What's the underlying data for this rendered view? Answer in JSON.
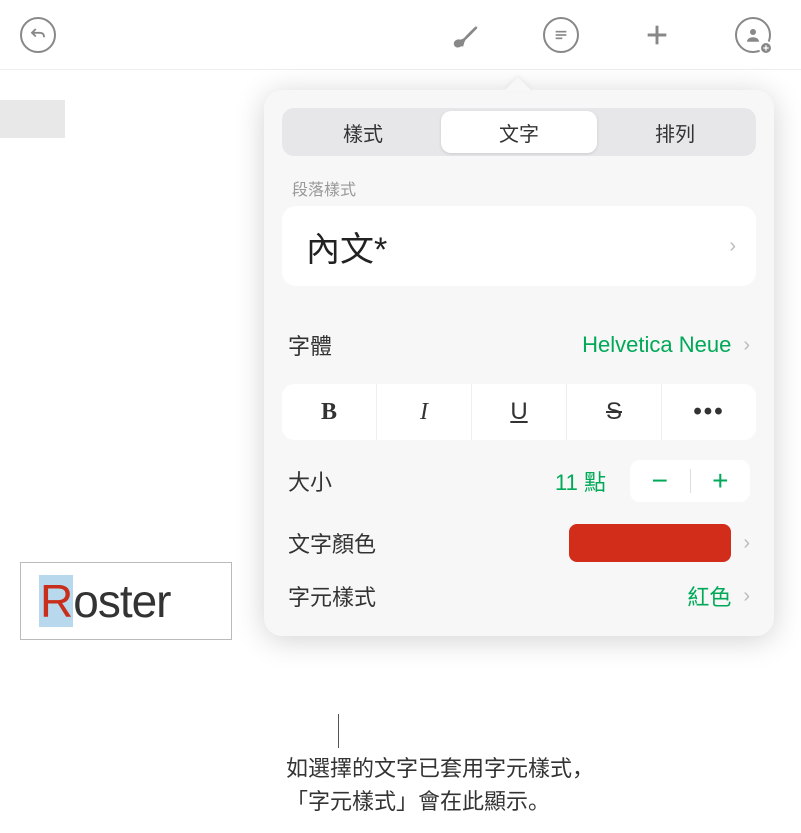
{
  "toolbar": {
    "back_icon": "undo",
    "paint_icon": "brush",
    "list_icon": "list",
    "add_icon": "plus",
    "share_icon": "collaborate"
  },
  "document": {
    "text_first": "R",
    "text_rest": "oster"
  },
  "popover": {
    "tabs": {
      "style": "樣式",
      "text": "文字",
      "arrange": "排列"
    },
    "paragraph_section_label": "段落樣式",
    "paragraph_style": "內文*",
    "font_label": "字體",
    "font_value": "Helvetica Neue",
    "style_buttons": {
      "bold": "B",
      "italic": "I",
      "underline": "U",
      "strike": "S",
      "more": "•••"
    },
    "size_label": "大小",
    "size_value": "11 點",
    "stepper_minus": "−",
    "stepper_plus": "+",
    "color_label": "文字顏色",
    "color_value": "#d22c1a",
    "char_style_label": "字元樣式",
    "char_style_value": "紅色"
  },
  "callout": {
    "line1": "如選擇的文字已套用字元樣式，",
    "line2": "「字元樣式」會在此顯示。"
  }
}
